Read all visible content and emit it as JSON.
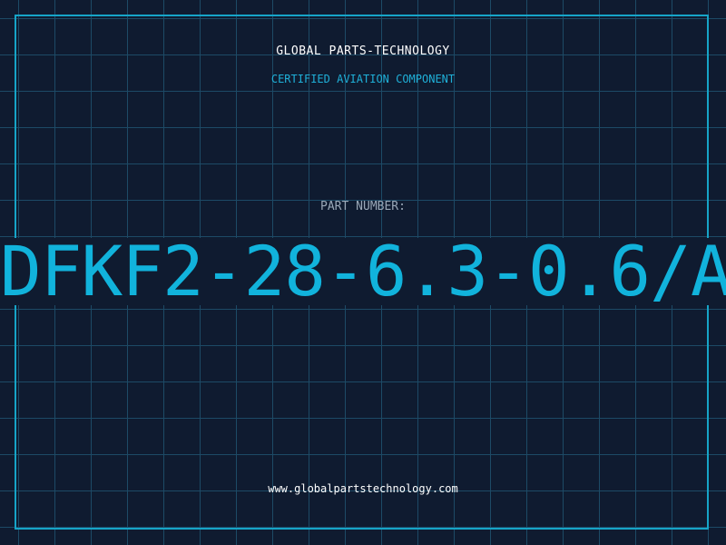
{
  "header": {
    "company": "GLOBAL PARTS-TECHNOLOGY",
    "tagline": "CERTIFIED AVIATION COMPONENT"
  },
  "part": {
    "label": "PART NUMBER:",
    "number": "DFKF2-28-6.3-0.6/A"
  },
  "footer": {
    "website": "www.globalpartstechnology.com"
  },
  "colors": {
    "background": "#0f1b30",
    "grid": "#1d4a66",
    "accent": "#11b3dc",
    "label": "#9aa8b8",
    "text": "#ffffff"
  }
}
